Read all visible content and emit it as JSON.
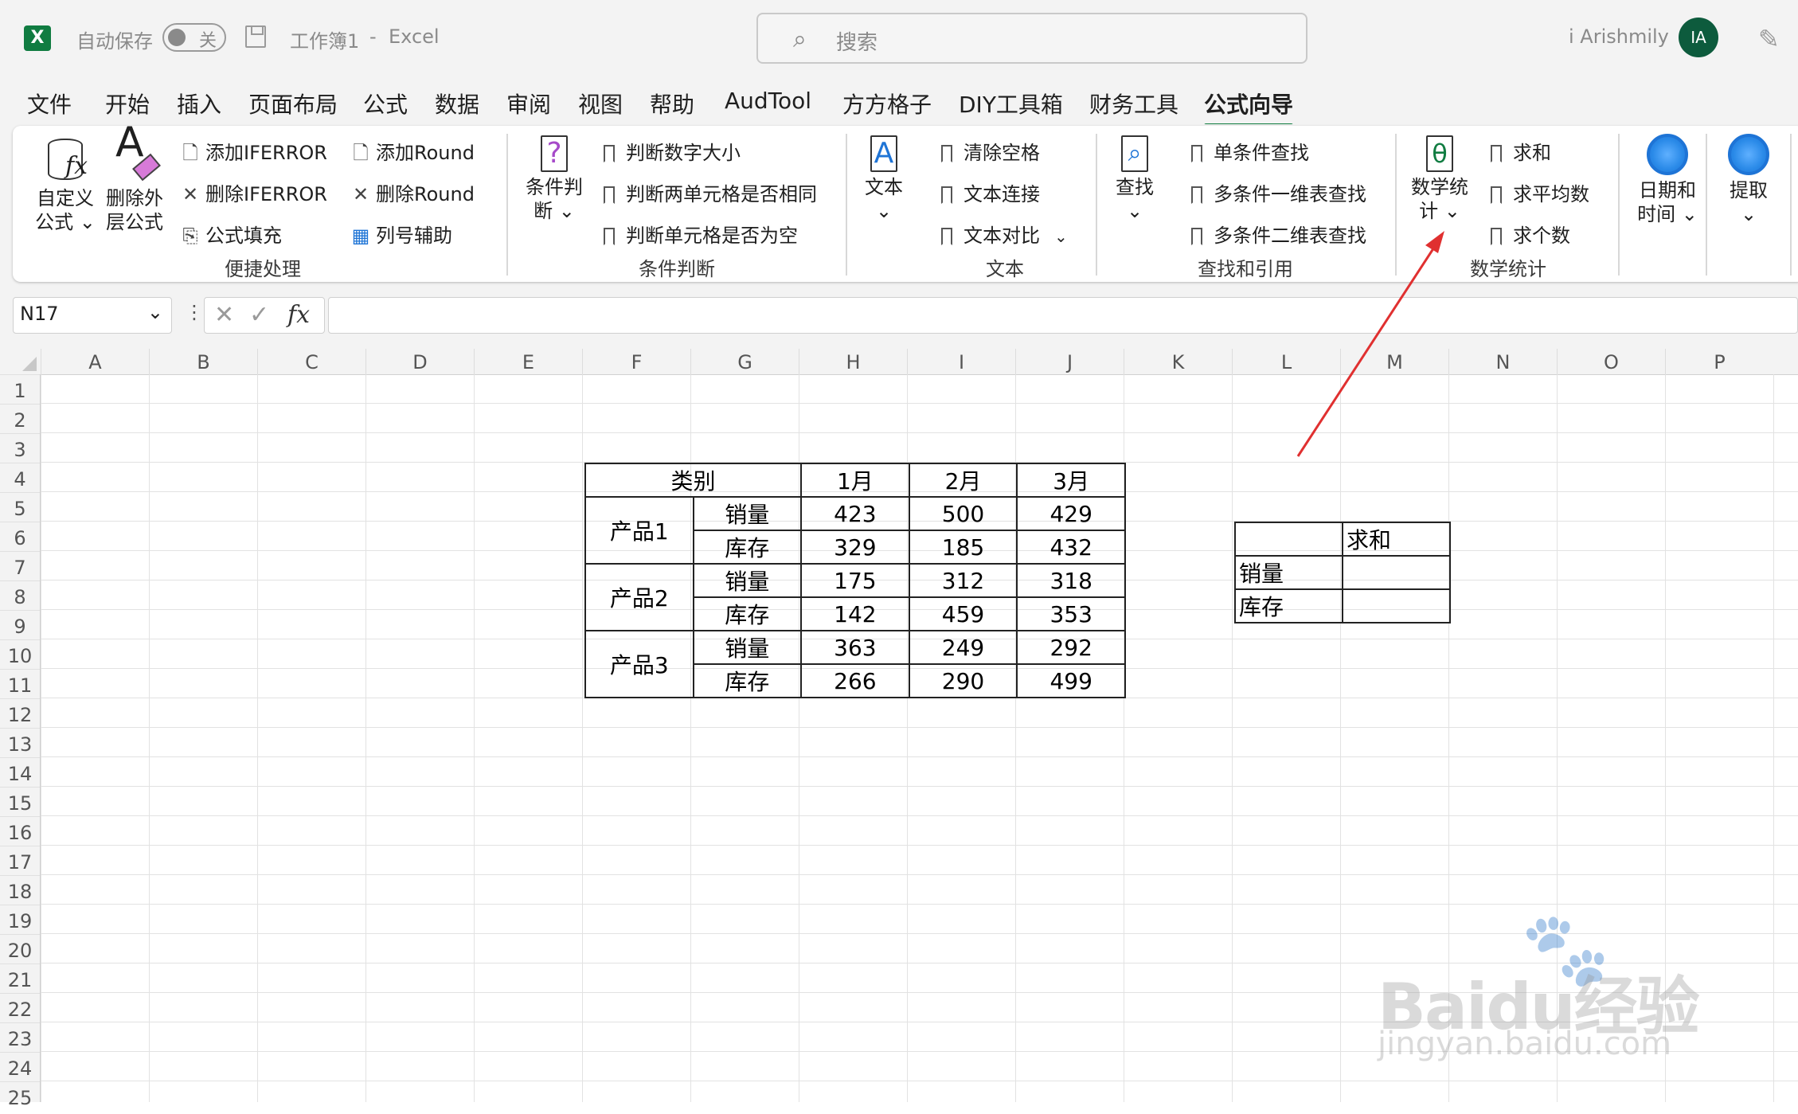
{
  "titlebar": {
    "app_badge": "X",
    "autosave_label": "自动保存",
    "toggle_state": "关",
    "workbook": "工作簿1",
    "separator": "-",
    "app_name": "Excel",
    "search_placeholder": "搜索",
    "user_name": "i Arishmily",
    "avatar_initials": "IA"
  },
  "tabs": [
    "文件",
    "开始",
    "插入",
    "页面布局",
    "公式",
    "数据",
    "审阅",
    "视图",
    "帮助",
    "AudTool",
    "方方格子",
    "DIY工具箱",
    "财务工具",
    "公式向导"
  ],
  "active_tab": "公式向导",
  "ribbon": {
    "group1": {
      "label": "便捷处理",
      "custom_formula": "自定义\n公式 ⌄",
      "remove_outer": "删除外\n层公式",
      "add_iferror": "添加IFERROR",
      "remove_iferror": "删除IFERROR",
      "formula_fill": "公式填充",
      "add_round": "添加Round",
      "remove_round": "删除Round",
      "column_helper": "列号辅助"
    },
    "group2": {
      "label": "条件判断",
      "condition": "条件判\n断 ⌄",
      "item1": "判断数字大小",
      "item2": "判断两单元格是否相同",
      "item3": "判断单元格是否为空"
    },
    "group3": {
      "label": "文本",
      "text": "文本\n⌄",
      "item1": "清除空格",
      "item2": "文本连接",
      "item3": "文本对比"
    },
    "group4": {
      "label": "查找和引用",
      "lookup": "查找\n⌄",
      "item1": "单条件查找",
      "item2": "多条件一维表查找",
      "item3": "多条件二维表查找"
    },
    "group5": {
      "label": "数学统计",
      "math": "数学统\n计 ⌄",
      "item1": "求和",
      "item2": "求平均数",
      "item3": "求个数"
    },
    "group6": {
      "datetime": "日期和\n时间 ⌄"
    },
    "group7": {
      "extract": "提取\n⌄"
    }
  },
  "formula_bar": {
    "name_box": "N17",
    "formula": ""
  },
  "columns": [
    "A",
    "B",
    "C",
    "D",
    "E",
    "F",
    "G",
    "H",
    "I",
    "J",
    "K",
    "L",
    "M",
    "N",
    "O",
    "P"
  ],
  "rows": [
    "1",
    "2",
    "3",
    "4",
    "5",
    "6",
    "7",
    "8",
    "9",
    "10",
    "11",
    "12",
    "13",
    "14",
    "15",
    "16",
    "17",
    "18",
    "19",
    "20",
    "21",
    "22",
    "23",
    "24",
    "25"
  ],
  "table1": {
    "header": {
      "category": "类别",
      "m1": "1月",
      "m2": "2月",
      "m3": "3月"
    },
    "products": [
      {
        "name": "产品1",
        "rows": [
          {
            "label": "销量",
            "v": [
              "423",
              "500",
              "429"
            ]
          },
          {
            "label": "库存",
            "v": [
              "329",
              "185",
              "432"
            ]
          }
        ]
      },
      {
        "name": "产品2",
        "rows": [
          {
            "label": "销量",
            "v": [
              "175",
              "312",
              "318"
            ]
          },
          {
            "label": "库存",
            "v": [
              "142",
              "459",
              "353"
            ]
          }
        ]
      },
      {
        "name": "产品3",
        "rows": [
          {
            "label": "销量",
            "v": [
              "363",
              "249",
              "292"
            ]
          },
          {
            "label": "库存",
            "v": [
              "266",
              "290",
              "499"
            ]
          }
        ]
      }
    ]
  },
  "table2": {
    "header": "求和",
    "row1": "销量",
    "row2": "库存"
  },
  "watermark": {
    "brand": "Baidu经验",
    "url": "jingyan.baidu.com"
  },
  "colors": {
    "excel_green": "#107c41",
    "arrow": "#e03030",
    "icon_blue": "#1e74d6"
  }
}
